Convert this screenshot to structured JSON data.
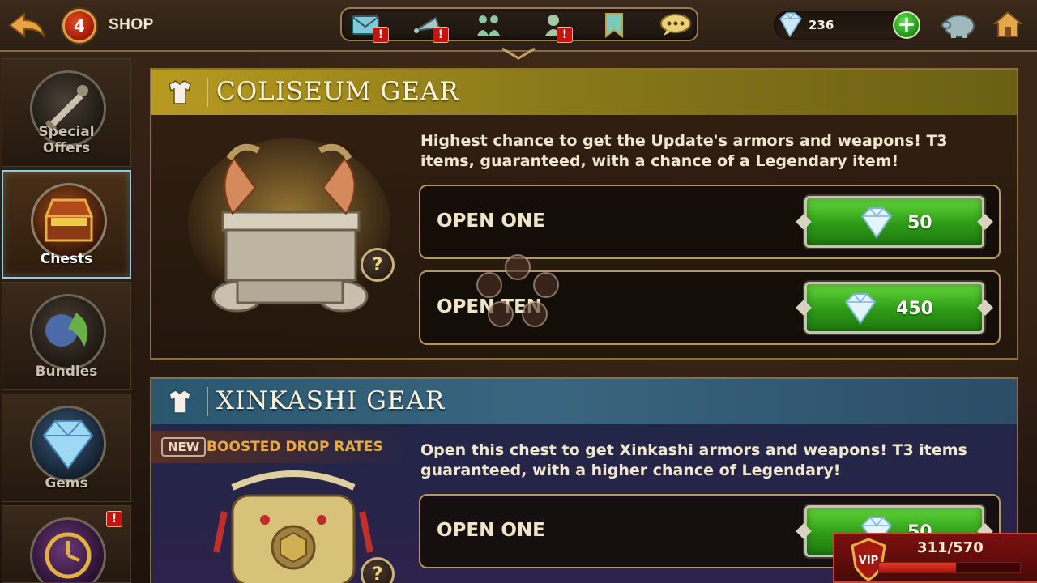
{
  "topbar": {
    "level": "4",
    "title": "SHOP",
    "gems": "236",
    "nav_icons": [
      "mail-icon",
      "horn-icon",
      "friends-icon",
      "guild-icon",
      "bookmark-icon",
      "chat-icon"
    ],
    "alert_mark": "!"
  },
  "sidebar": {
    "items": [
      {
        "label": "Special Offers",
        "icon": "sword-icon",
        "active": false
      },
      {
        "label": "Chests",
        "icon": "chest-icon",
        "active": true
      },
      {
        "label": "Bundles",
        "icon": "bundle-icon",
        "active": false
      },
      {
        "label": "Gems",
        "icon": "gem-icon",
        "active": false
      },
      {
        "label": "",
        "icon": "clock-icon",
        "active": false,
        "alert": "!"
      }
    ]
  },
  "coliseum": {
    "title": "COLISEUM GEAR",
    "description": "Highest chance to get the Update's armors and weapons! T3 items, guaranteed, with a chance of a Legendary item!",
    "help": "?",
    "options": [
      {
        "label": "OPEN ONE",
        "price": "50"
      },
      {
        "label": "OPEN TEN",
        "price": "450"
      }
    ]
  },
  "xinkashi": {
    "title": "XINKASHI GEAR",
    "new_tag": "NEW",
    "boost_text": "BOOSTED DROP RATES",
    "description": "Open this chest to get Xinkashi armors and weapons! T3 items guaranteed, with a higher chance of Legendary!",
    "help": "?",
    "options": [
      {
        "label": "OPEN ONE",
        "price": "50"
      }
    ]
  },
  "vip": {
    "label": "VIP",
    "progress_text": "311/570",
    "progress_fraction": 0.546
  },
  "colors": {
    "accent_gold": "#b79a20",
    "price_green": "#2e9a17",
    "vip_red": "#7a1010"
  }
}
